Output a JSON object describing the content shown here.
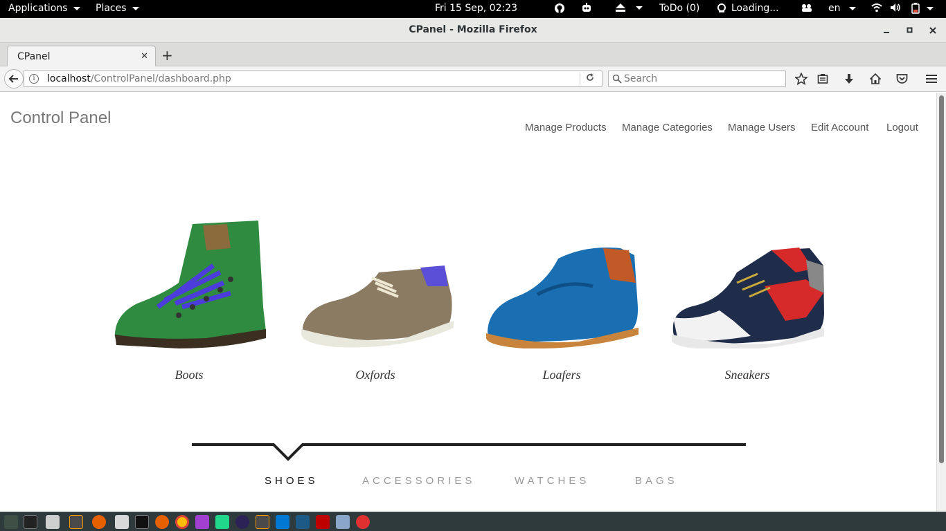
{
  "system_bar": {
    "applications": "Applications",
    "places": "Places",
    "datetime": "Fri 15 Sep, 02:23",
    "todo": "ToDo (0)",
    "loading": "Loading...",
    "language": "en"
  },
  "window": {
    "title": "CPanel - Mozilla Firefox"
  },
  "browser": {
    "tab_title": "CPanel",
    "url_host": "localhost",
    "url_path": "/ControlPanel/dashboard.php",
    "search_placeholder": "Search"
  },
  "page": {
    "brand": "Control Panel",
    "nav": [
      "Manage Products",
      "Manage Categories",
      "Manage Users",
      "Edit Account",
      "Logout"
    ],
    "products": [
      {
        "label": "Boots",
        "image": "green-hiking-boot"
      },
      {
        "label": "Oxfords",
        "image": "taupe-oxford-shoe"
      },
      {
        "label": "Loafers",
        "image": "blue-penny-loafer"
      },
      {
        "label": "Sneakers",
        "image": "navy-red-high-top-sneaker"
      }
    ],
    "categories": [
      "SHOES",
      "ACCESSORIES",
      "WATCHES",
      "BAGS"
    ],
    "active_category": "SHOES"
  },
  "taskbar_icons": [
    "show-desktop-icon",
    "terminal-icon",
    "files-icon",
    "sublime-text-icon",
    "firefox-icon",
    "text-editor-icon",
    "terminal-icon",
    "firefox-icon",
    "chrome-icon",
    "phpstorm-icon",
    "pycharm-icon",
    "eclipse-icon",
    "sublime-text-icon",
    "vscode-icon",
    "mysql-workbench-icon",
    "filezilla-icon",
    "inkscape-icon",
    "unity-icon"
  ],
  "colors": {
    "top_bar": "#000000",
    "taskbar": "#2f3a3c",
    "brand_text": "#777777",
    "active_category": "#111111",
    "inactive_category": "#999999",
    "divider": "#222222"
  }
}
